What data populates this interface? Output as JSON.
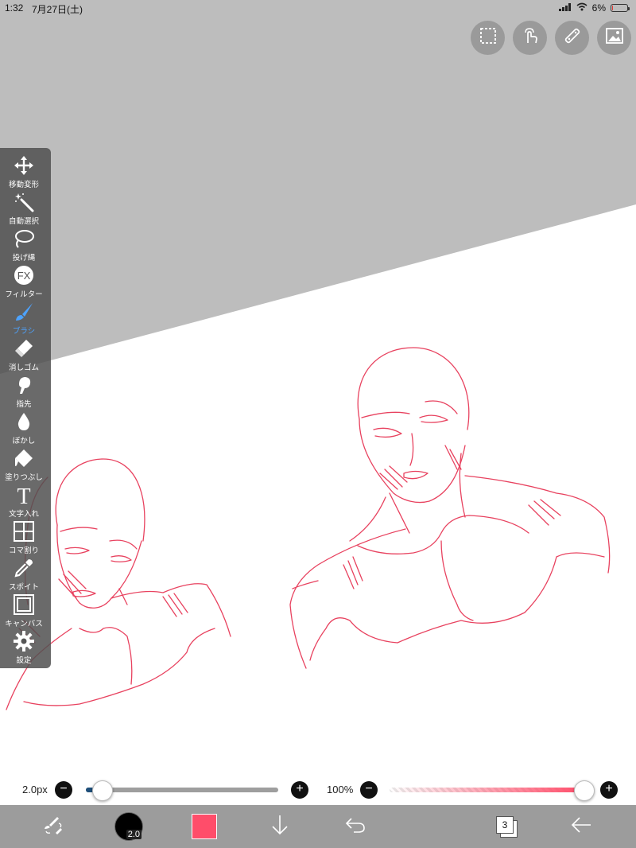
{
  "status_bar": {
    "time": "1:32",
    "date": "7月27日(土)",
    "battery": "6%",
    "battery_level": 0.06
  },
  "top_tools": [
    {
      "icon": "selection-icon"
    },
    {
      "icon": "touch-icon"
    },
    {
      "icon": "ruler-icon"
    },
    {
      "icon": "gallery-icon"
    }
  ],
  "sidebar": {
    "items": [
      {
        "label": "移動変形",
        "icon": "move-icon"
      },
      {
        "label": "自動選択",
        "icon": "magic-wand-icon"
      },
      {
        "label": "投げ縄",
        "icon": "lasso-icon"
      },
      {
        "label": "フィルター",
        "icon": "fx-icon",
        "icon_text": "FX"
      },
      {
        "label": "ブラシ",
        "icon": "brush-icon",
        "active": true
      },
      {
        "label": "消しゴム",
        "icon": "eraser-icon"
      },
      {
        "label": "指先",
        "icon": "smudge-icon"
      },
      {
        "label": "ぼかし",
        "icon": "blur-icon"
      },
      {
        "label": "塗りつぶし",
        "icon": "fill-icon"
      },
      {
        "label": "文字入れ",
        "icon": "text-icon",
        "icon_text": "T"
      },
      {
        "label": "コマ割り",
        "icon": "frame-icon"
      },
      {
        "label": "スポイト",
        "icon": "eyedropper-icon"
      },
      {
        "label": "キャンバス",
        "icon": "canvas-icon"
      },
      {
        "label": "設定",
        "icon": "gear-icon"
      }
    ]
  },
  "brush_size": {
    "label": "2.0px",
    "value_fraction": 0.04
  },
  "opacity": {
    "label": "100%",
    "value_fraction": 1.0
  },
  "bottom_bar": {
    "brush_size_badge": "2.0",
    "current_color": "#ff4d6a",
    "layers_count": "3"
  },
  "colors": {
    "sketch_stroke": "#e8425f",
    "canvas_background": "#ffffff",
    "outside_canvas": "#bdbdbd",
    "active_tool": "#4da3ff"
  }
}
